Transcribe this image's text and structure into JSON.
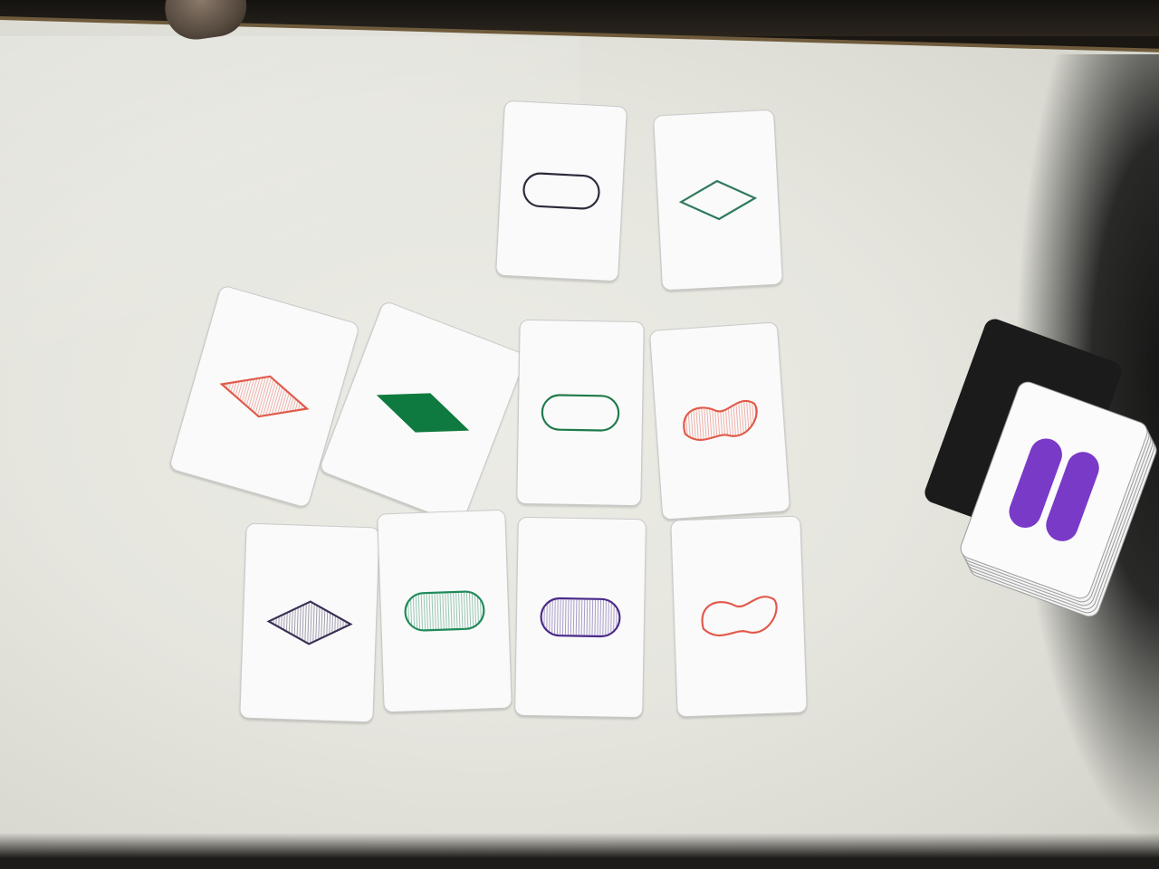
{
  "scene": {
    "description_free": true
  },
  "cards": [
    {
      "id": "card-1",
      "shape": "oval",
      "color": "#2a2a3a",
      "shading": "open",
      "count": 1
    },
    {
      "id": "card-2",
      "shape": "diamond",
      "color": "#2f7a5a",
      "shading": "open",
      "count": 1
    },
    {
      "id": "card-3",
      "shape": "diamond",
      "color": "#e05a4a",
      "shading": "striped",
      "count": 1
    },
    {
      "id": "card-4",
      "shape": "diamond",
      "color": "#0f7a3f",
      "shading": "solid",
      "count": 1
    },
    {
      "id": "card-5",
      "shape": "oval",
      "color": "#1f7a4a",
      "shading": "open",
      "count": 1
    },
    {
      "id": "card-6",
      "shape": "squiggle",
      "color": "#e05a4a",
      "shading": "striped",
      "count": 1
    },
    {
      "id": "card-7",
      "shape": "diamond",
      "color": "#3a2f55",
      "shading": "striped",
      "count": 1
    },
    {
      "id": "card-8",
      "shape": "oval",
      "color": "#1f8a5a",
      "shading": "striped",
      "count": 1
    },
    {
      "id": "card-9",
      "shape": "oval",
      "color": "#4a2a8a",
      "shading": "striped",
      "count": 1
    },
    {
      "id": "card-10",
      "shape": "squiggle",
      "color": "#e05a4a",
      "shading": "open",
      "count": 1
    }
  ],
  "deck": {
    "top_card": {
      "shape": "oval",
      "color": "#7a3ac8",
      "shading": "solid",
      "count": 2
    }
  }
}
